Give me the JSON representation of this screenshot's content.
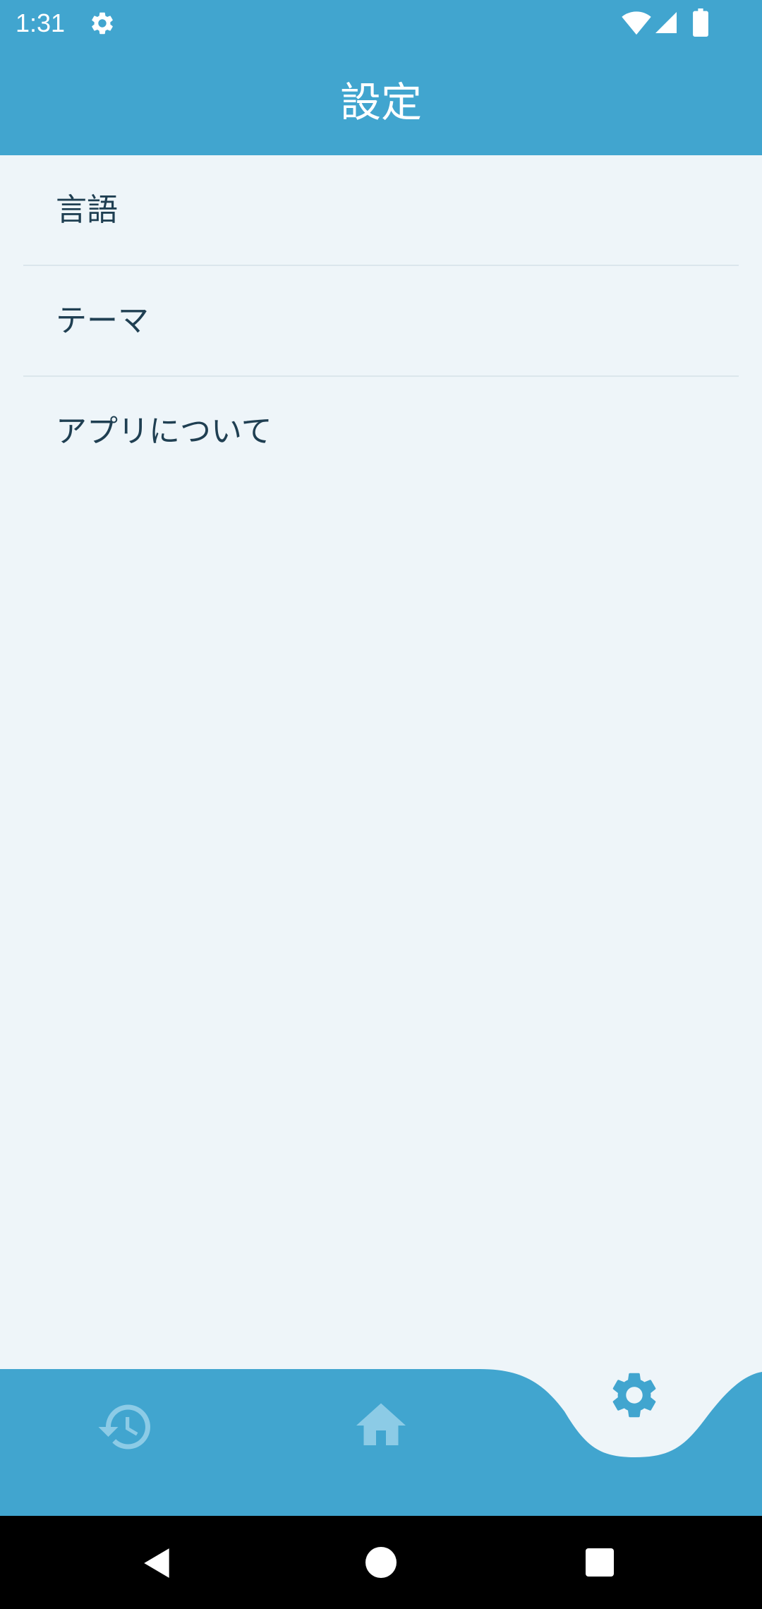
{
  "status_bar": {
    "time": "1:31",
    "icons": [
      "gear-icon",
      "wifi-icon",
      "signal-icon",
      "battery-icon"
    ]
  },
  "app_bar": {
    "title": "設定"
  },
  "settings": {
    "items": [
      {
        "label": "言語"
      },
      {
        "label": "テーマ"
      },
      {
        "label": "アプリについて"
      }
    ]
  },
  "bottom_nav": {
    "items": [
      {
        "icon": "history-icon",
        "active": false
      },
      {
        "icon": "home-icon",
        "active": false
      },
      {
        "icon": "gear-icon",
        "active": true
      }
    ]
  },
  "colors": {
    "primary": "#41a5cf",
    "background": "#eef5f9",
    "text": "#1f3f52",
    "inactive_icon": "#8ccbe6"
  }
}
